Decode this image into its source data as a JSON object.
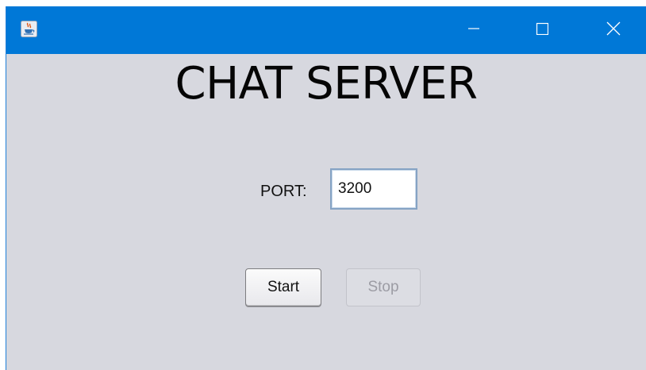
{
  "window": {
    "controls": {
      "minimize_icon": "minimize-icon",
      "maximize_icon": "maximize-icon",
      "close_icon": "close-icon"
    },
    "app_icon": "java-coffee-cup-icon",
    "titlebar_color": "#0078d7",
    "background_color": "#d7d8df"
  },
  "main": {
    "title": "CHAT SERVER",
    "port_label": "PORT:",
    "port_value": "3200",
    "start_label": "Start",
    "stop_label": "Stop",
    "stop_enabled": false
  }
}
